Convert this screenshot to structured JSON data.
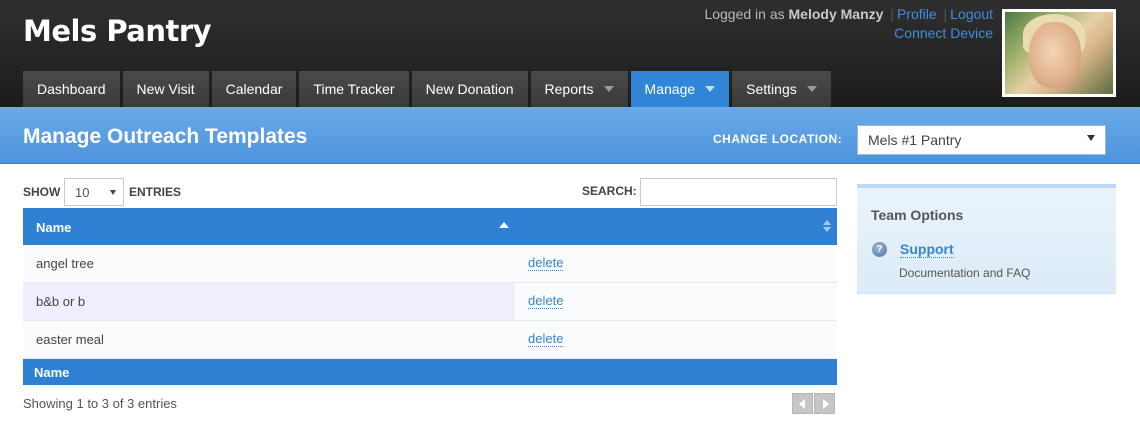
{
  "app": {
    "title": "Mels Pantry"
  },
  "user": {
    "prefix": "Logged in as",
    "name": "Melody Manzy",
    "profile_label": "Profile",
    "logout_label": "Logout",
    "connect_label": "Connect Device"
  },
  "nav": {
    "dashboard": "Dashboard",
    "new_visit": "New Visit",
    "calendar": "Calendar",
    "time_tracker": "Time Tracker",
    "new_donation": "New Donation",
    "reports": "Reports",
    "manage": "Manage",
    "settings": "Settings",
    "active": "Manage"
  },
  "page": {
    "title": "Manage Outreach Templates",
    "location_label": "CHANGE LOCATION:",
    "location_value": "Mels #1 Pantry"
  },
  "table_controls": {
    "show_label": "SHOW",
    "page_length": "10",
    "entries_label": "ENTRIES",
    "search_label": "SEARCH:",
    "search_value": ""
  },
  "table": {
    "header_name": "Name",
    "footer_name": "Name",
    "rows": [
      {
        "name": "angel tree",
        "action": "delete"
      },
      {
        "name": "b&b or b",
        "action": "delete"
      },
      {
        "name": "easter meal",
        "action": "delete"
      }
    ],
    "info": "Showing 1 to 3 of 3 entries"
  },
  "team_options": {
    "title": "Team Options",
    "support_label": "Support",
    "support_desc": "Documentation and FAQ"
  },
  "colors": {
    "accent": "#2f7fd3",
    "header_bg": "#262626",
    "link": "#3a84c8"
  }
}
